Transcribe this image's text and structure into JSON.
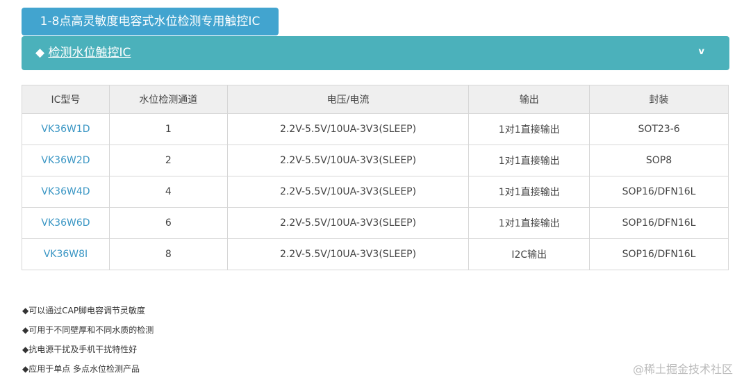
{
  "title": "1-8点高灵敏度电容式水位检测专用触控IC",
  "accordion": {
    "bullet": "◆",
    "label": "检测水位触控IC",
    "chevron": "v"
  },
  "table": {
    "headers": [
      "IC型号",
      "水位检测通道",
      "电压/电流",
      "输出",
      "封装"
    ],
    "rows": [
      [
        "VK36W1D",
        "1",
        "2.2V-5.5V/10UA-3V3(SLEEP)",
        "1对1直接输出",
        "SOT23-6"
      ],
      [
        "VK36W2D",
        "2",
        "2.2V-5.5V/10UA-3V3(SLEEP)",
        "1对1直接输出",
        "SOP8"
      ],
      [
        "VK36W4D",
        "4",
        "2.2V-5.5V/10UA-3V3(SLEEP)",
        "1对1直接输出",
        "SOP16/DFN16L"
      ],
      [
        "VK36W6D",
        "6",
        "2.2V-5.5V/10UA-3V3(SLEEP)",
        "1对1直接输出",
        "SOP16/DFN16L"
      ],
      [
        "VK36W8I",
        "8",
        "2.2V-5.5V/10UA-3V3(SLEEP)",
        "I2C输出",
        "SOP16/DFN16L"
      ]
    ]
  },
  "notes": [
    "◆可以通过CAP脚电容调节灵敏度",
    "◆可用于不同壁厚和不同水质的检测",
    "◆抗电源干扰及手机干扰特性好",
    "◆应用于单点 多点水位检测产品"
  ],
  "watermark": "@稀土掘金技术社区"
}
